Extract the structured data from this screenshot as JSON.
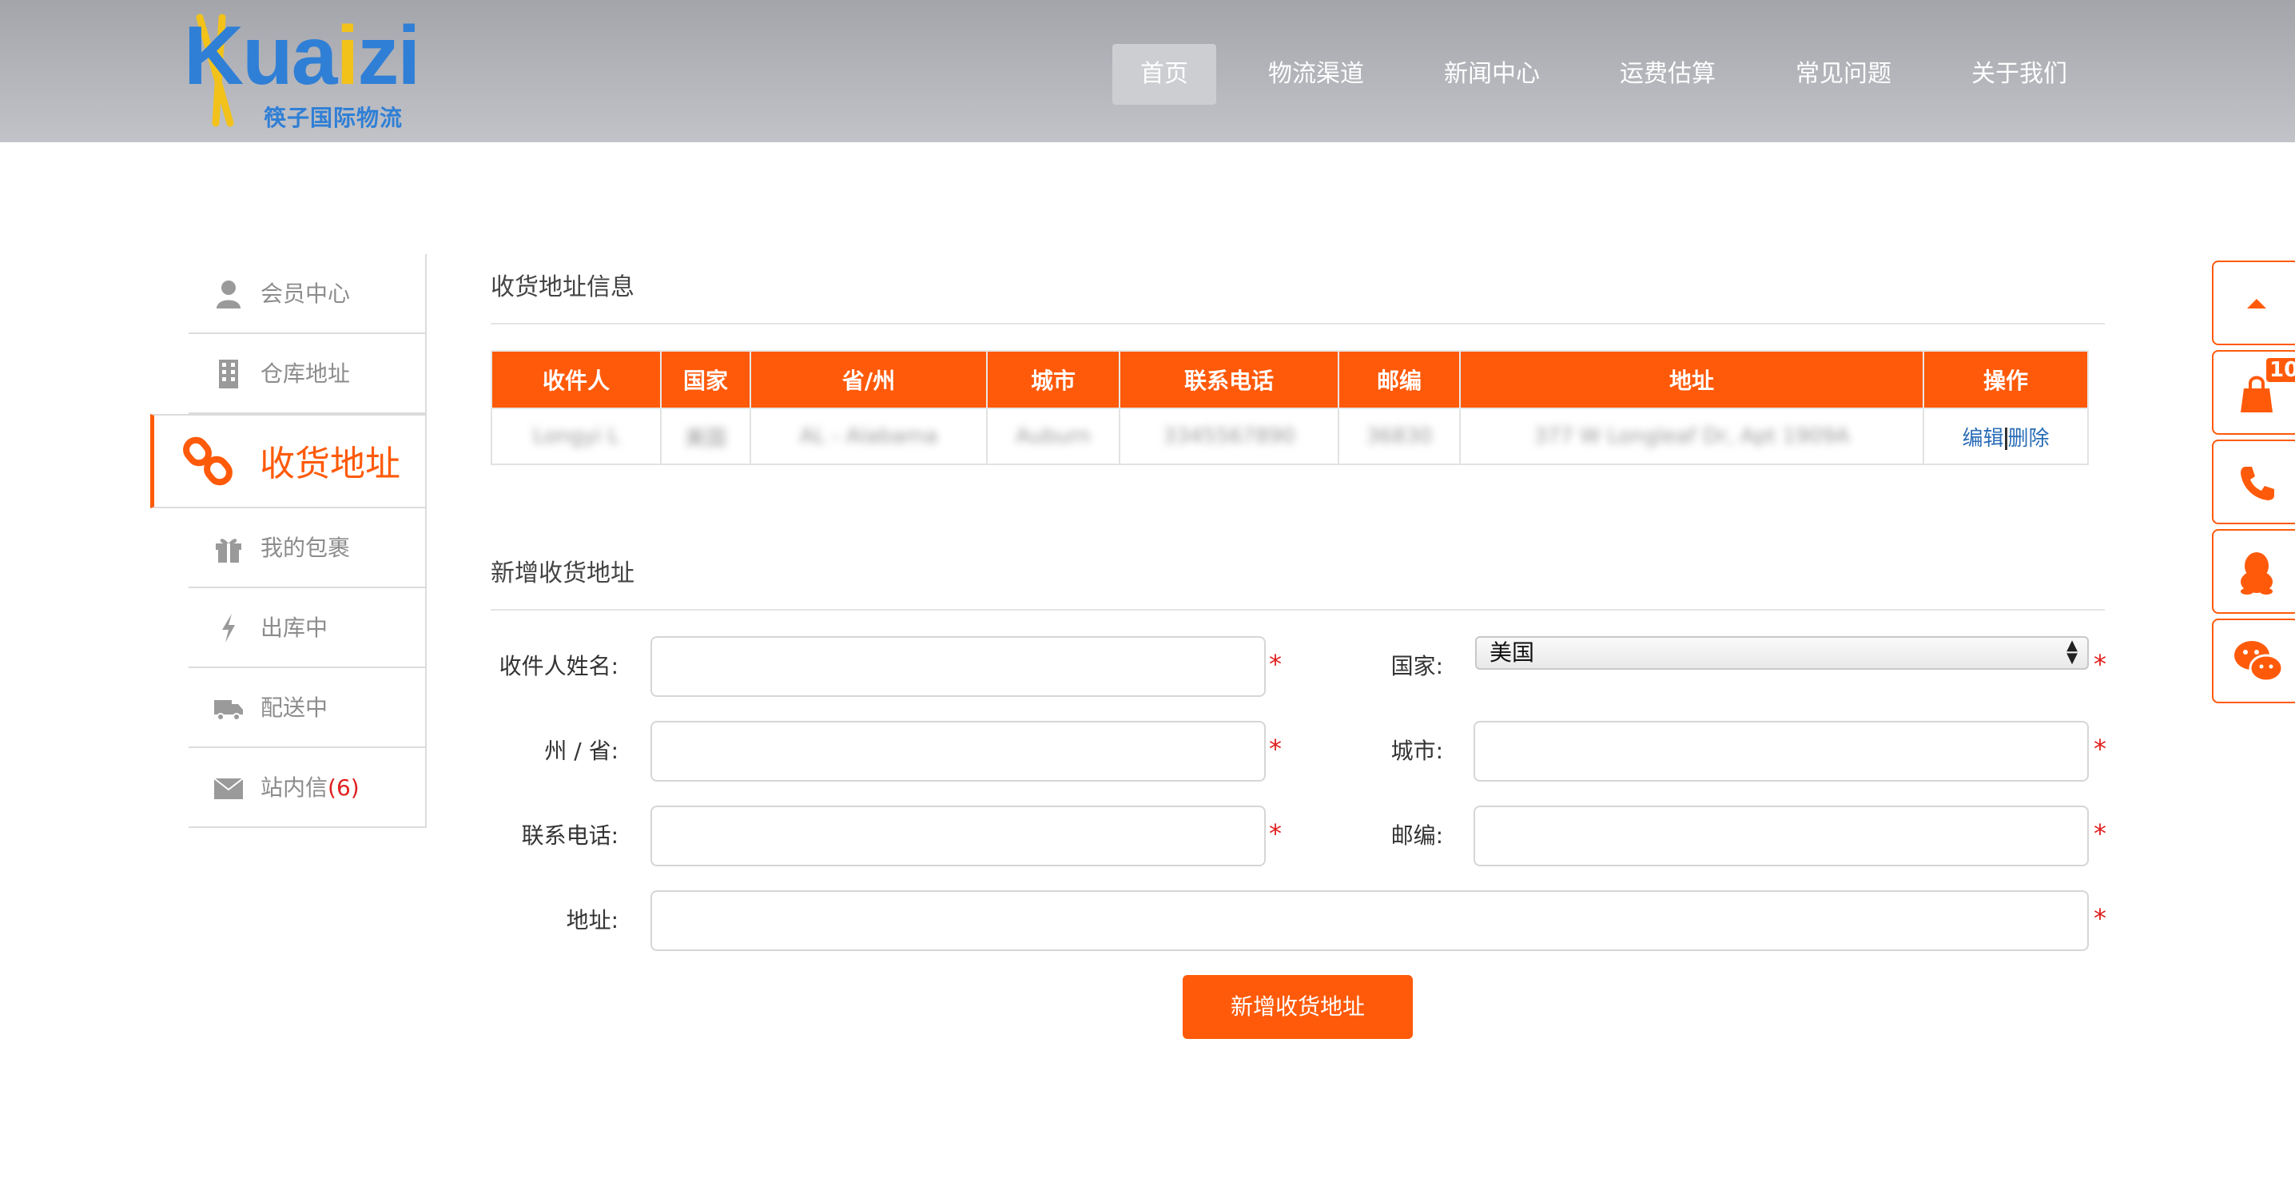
{
  "brand": {
    "logo_word": "Kuaizi",
    "logo_sub": "筷子国际物流"
  },
  "nav": [
    {
      "label": "首页",
      "active": true
    },
    {
      "label": "物流渠道"
    },
    {
      "label": "新闻中心"
    },
    {
      "label": "运费估算"
    },
    {
      "label": "常见问题"
    },
    {
      "label": "关于我们"
    }
  ],
  "sidebar": {
    "items": [
      {
        "label": "会员中心",
        "icon": "user-icon"
      },
      {
        "label": "仓库地址",
        "icon": "building-icon"
      },
      {
        "label": "收货地址",
        "icon": "link-icon",
        "active": true
      },
      {
        "label": "我的包裹",
        "icon": "gift-icon"
      },
      {
        "label": "出库中",
        "icon": "bolt-icon"
      },
      {
        "label": "配送中",
        "icon": "truck-icon"
      },
      {
        "label": "站内信",
        "icon": "envelope-icon",
        "count": "(6)"
      }
    ]
  },
  "address_info": {
    "title": "收货地址信息",
    "columns": [
      "收件人",
      "国家",
      "省/州",
      "城市",
      "联系电话",
      "邮编",
      "地址",
      "操作"
    ],
    "rows": [
      {
        "cells": [
          "Longyi L",
          "美国",
          "AL - Alabama",
          "Auburn",
          "3345567890",
          "36830",
          "377 W Longleaf Dr, Apt 1909A"
        ],
        "edit_label": "编辑",
        "delete_label": "删除"
      }
    ]
  },
  "new_address": {
    "title": "新增收货地址",
    "labels": {
      "name": "收件人姓名:",
      "country": "国家:",
      "state": "州 / 省:",
      "city": "城市:",
      "phone": "联系电话:",
      "zip": "邮编:",
      "address": "地址:"
    },
    "required_mark": "*",
    "country_value": "美国",
    "submit_label": "新增收货地址"
  },
  "float_bar": {
    "cart_badge": "10",
    "buttons": [
      "arrow-up-icon",
      "shopping-bag-icon",
      "phone-icon",
      "qq-icon",
      "wechat-icon"
    ]
  },
  "colors": {
    "accent": "#ff5a0a",
    "header_bg": "#a3a5ab",
    "link": "#2a6db7",
    "required": "#e02020"
  }
}
